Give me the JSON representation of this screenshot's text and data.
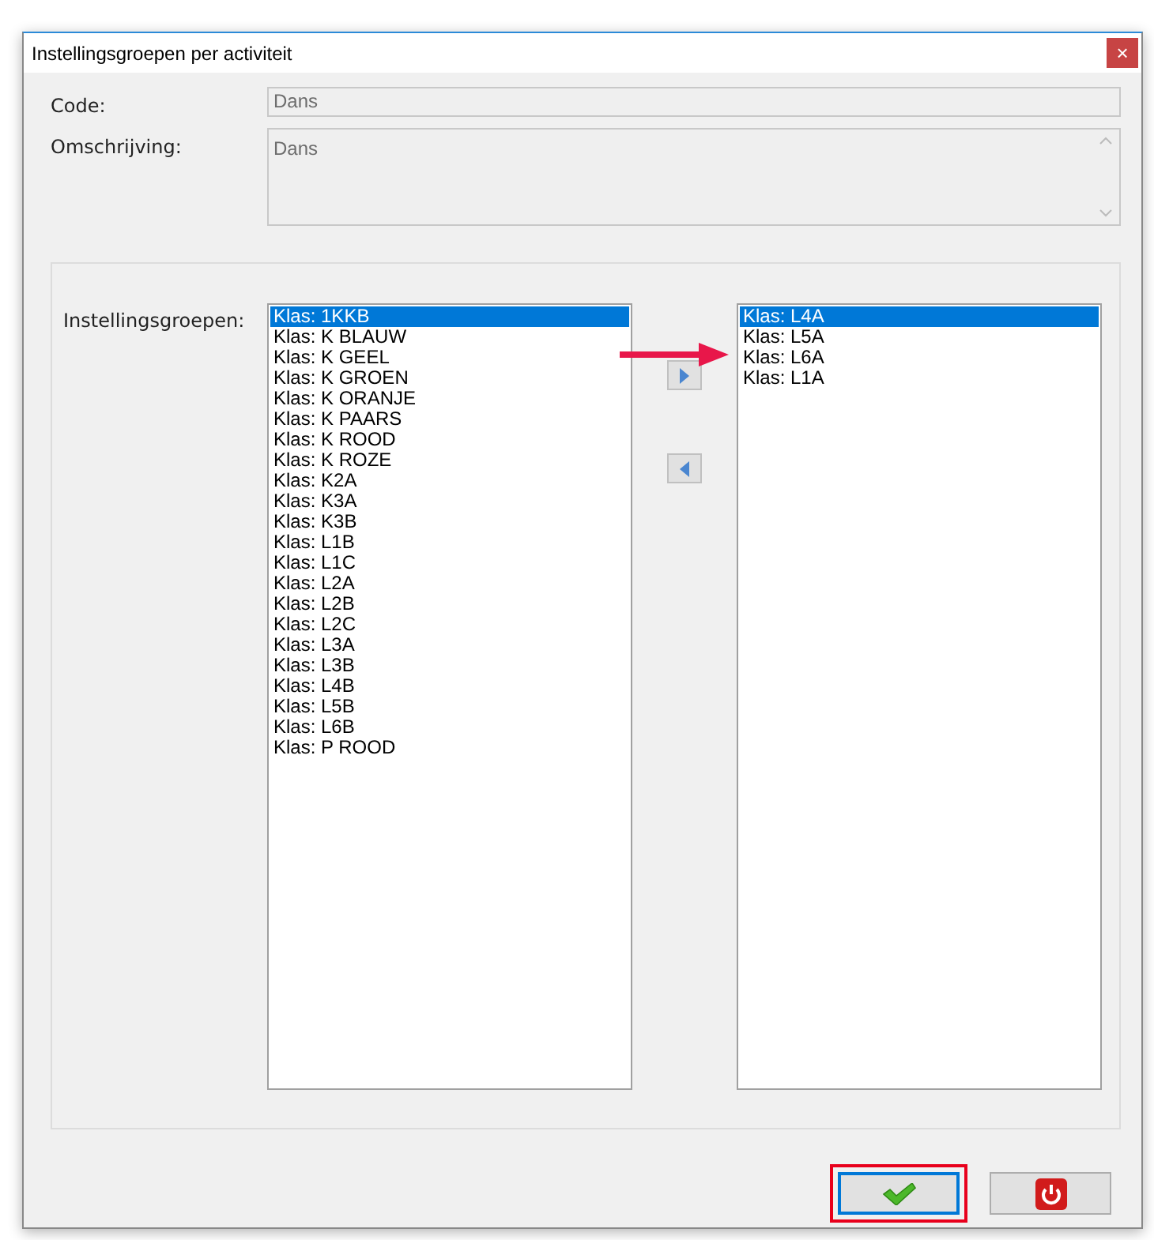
{
  "window": {
    "title": "Instellingsgroepen per activiteit",
    "close": "×"
  },
  "code": {
    "label": "Code:",
    "value": "Dans"
  },
  "omschrijving": {
    "label": "Omschrijving:",
    "value": "Dans"
  },
  "instellingsgroepen": {
    "label": "Instellingsgroepen:",
    "available": [
      {
        "text": "Klas: 1KKB",
        "selected": true
      },
      {
        "text": "Klas: K BLAUW",
        "selected": false
      },
      {
        "text": "Klas: K GEEL",
        "selected": false
      },
      {
        "text": "Klas: K GROEN",
        "selected": false
      },
      {
        "text": "Klas: K ORANJE",
        "selected": false
      },
      {
        "text": "Klas: K PAARS",
        "selected": false
      },
      {
        "text": "Klas: K ROOD",
        "selected": false
      },
      {
        "text": "Klas: K ROZE",
        "selected": false
      },
      {
        "text": "Klas: K2A",
        "selected": false
      },
      {
        "text": "Klas: K3A",
        "selected": false
      },
      {
        "text": "Klas: K3B",
        "selected": false
      },
      {
        "text": "Klas: L1B",
        "selected": false
      },
      {
        "text": "Klas: L1C",
        "selected": false
      },
      {
        "text": "Klas: L2A",
        "selected": false
      },
      {
        "text": "Klas: L2B",
        "selected": false
      },
      {
        "text": "Klas: L2C",
        "selected": false
      },
      {
        "text": "Klas: L3A",
        "selected": false
      },
      {
        "text": "Klas: L3B",
        "selected": false
      },
      {
        "text": "Klas: L4B",
        "selected": false
      },
      {
        "text": "Klas: L5B",
        "selected": false
      },
      {
        "text": "Klas: L6B",
        "selected": false
      },
      {
        "text": "Klas: P ROOD",
        "selected": false
      }
    ],
    "assigned": [
      {
        "text": "Klas: L4A",
        "selected": true
      },
      {
        "text": "Klas: L5A",
        "selected": false
      },
      {
        "text": "Klas: L6A",
        "selected": false
      },
      {
        "text": "Klas: L1A",
        "selected": false
      }
    ]
  },
  "buttons": [
    {
      "kind": "ok",
      "focused": true,
      "highlighted": true
    },
    {
      "kind": "close",
      "focused": false,
      "highlighted": false
    }
  ]
}
